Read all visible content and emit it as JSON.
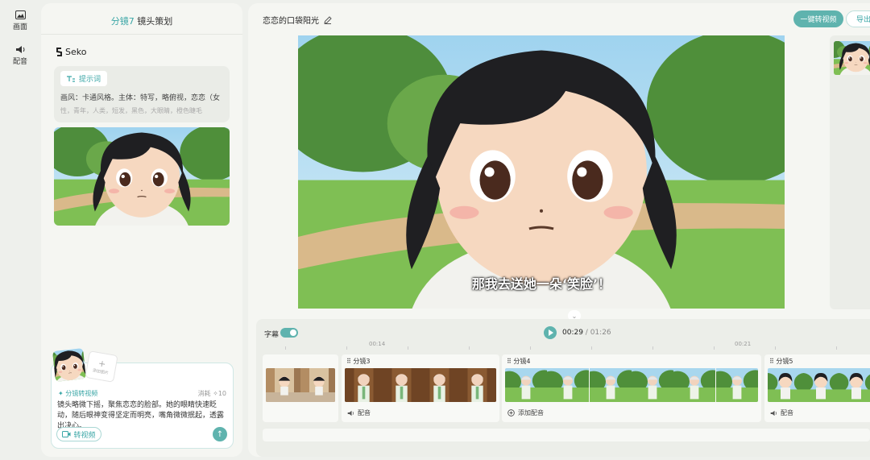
{
  "sidebar": {
    "items": [
      {
        "label": "画面",
        "icon": "image-icon"
      },
      {
        "label": "配音",
        "icon": "speaker-icon"
      }
    ]
  },
  "left_panel": {
    "title_highlight": "分镜7",
    "title_rest": "镜头策划",
    "brand": "Seko",
    "prompt_tag": "提示词",
    "prompt_line1": "画风：卡通风格。主体：特写，略俯视，恋恋（女",
    "prompt_line2": "性，青年，人类，短发，黑色，大眼睛，橙色睫毛",
    "composer": {
      "add_ref_label": "添加图片",
      "mode_label": "分镜转视频",
      "cost_label": "消耗",
      "cost_value": "10",
      "text": "镜头略微下摇，聚焦恋恋的脸部。她的眼睛快速眨动，随后眼神变得坚定而明亮，嘴角微微抿起，透露出决心。",
      "convert_button": "转视频"
    }
  },
  "main": {
    "project_title": "恋恋的口袋阳光",
    "one_click_button": "一键转视频",
    "export_button": "导出",
    "subtitle": "那我去送她一朵‘笑脸’！"
  },
  "timeline": {
    "subtitle_toggle_label": "字幕",
    "current_time": "00:29",
    "separator": " / ",
    "total_time": "01:26",
    "ruler_labels": [
      "00:14",
      "00:21"
    ],
    "clips": [
      {
        "label": "",
        "footer": "",
        "footer_icon": ""
      },
      {
        "label": "分镜3",
        "footer": "配音",
        "footer_icon": "speaker-icon"
      },
      {
        "label": "分镜4",
        "footer": "添加配音",
        "footer_icon": "add-circle-icon"
      },
      {
        "label": "分镜5",
        "footer": "配音",
        "footer_icon": "speaker-icon"
      }
    ]
  },
  "colors": {
    "accent": "#5fb3ae",
    "accent_text": "#3aa6a6",
    "panel": "#f5f6f2",
    "background": "#eef0ec"
  }
}
